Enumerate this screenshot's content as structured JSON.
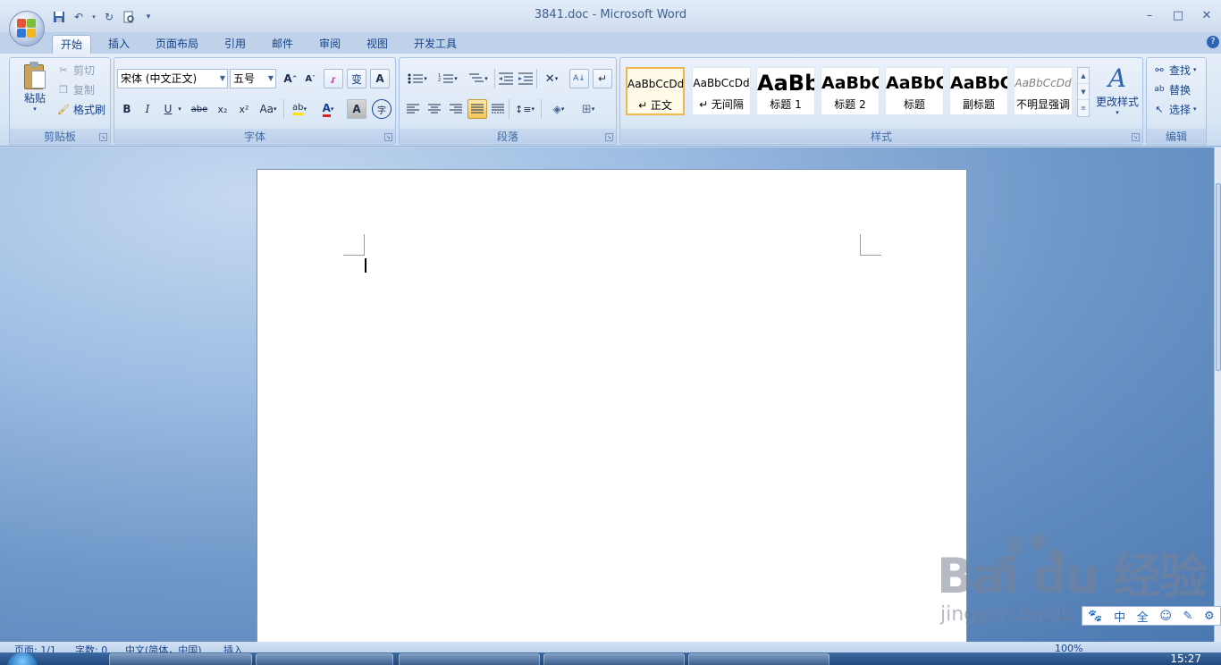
{
  "window": {
    "title": "3841.doc - Microsoft Word",
    "minimize": "–",
    "maximize": "□",
    "close": "✕"
  },
  "tabs": [
    "开始",
    "插入",
    "页面布局",
    "引用",
    "邮件",
    "审阅",
    "视图",
    "开发工具"
  ],
  "clipboard": {
    "paste": "粘贴",
    "cut": "剪切",
    "copy": "复制",
    "format_painter": "格式刷",
    "group_label": "剪贴板"
  },
  "font": {
    "font_name": "宋体 (中文正文)",
    "font_size": "五号",
    "group_label": "字体",
    "grow": "A",
    "shrink": "A",
    "clear_format": "ꭉ",
    "phonetic": "变",
    "char_border": "A",
    "bold": "B",
    "italic": "I",
    "underline": "U",
    "strike": "abe",
    "subscript": "x₂",
    "superscript": "x²",
    "change_case": "Aa",
    "highlight": "ab",
    "font_color": "A",
    "char_shading": "A",
    "enclose": "字"
  },
  "paragraph": {
    "group_label": "段落"
  },
  "styles": {
    "group_label": "样式",
    "items": [
      {
        "sample": "AaBbCcDd",
        "name": "↵ 正文"
      },
      {
        "sample": "AaBbCcDd",
        "name": "↵ 无间隔"
      },
      {
        "sample": "AaBb",
        "name": "标题 1"
      },
      {
        "sample": "AaBbC",
        "name": "标题 2"
      },
      {
        "sample": "AaBbC",
        "name": "标题"
      },
      {
        "sample": "AaBbC",
        "name": "副标题"
      },
      {
        "sample": "AaBbCcDd",
        "name": "不明显强调"
      }
    ],
    "change_styles": "更改样式"
  },
  "editing": {
    "find": "查找",
    "replace": "替换",
    "select": "选择",
    "group_label": "编辑"
  },
  "statusbar": {
    "page": "页面: 1/1",
    "words": "字数: 0",
    "language": "中文(简体，中国)",
    "mode": "插入",
    "zoom": "100%"
  },
  "watermark": {
    "logo": "Bai  du 经验",
    "url": "jingyan.baidu.com",
    "ime": [
      "🐾",
      "中",
      "全",
      "☺",
      "✎",
      "⚙"
    ]
  },
  "taskbar": {
    "clock": "15:27"
  },
  "colors": {
    "ribbon_bg": "#dce8f6",
    "accent": "#15428b",
    "selected_style_border": "#f1b74a"
  }
}
